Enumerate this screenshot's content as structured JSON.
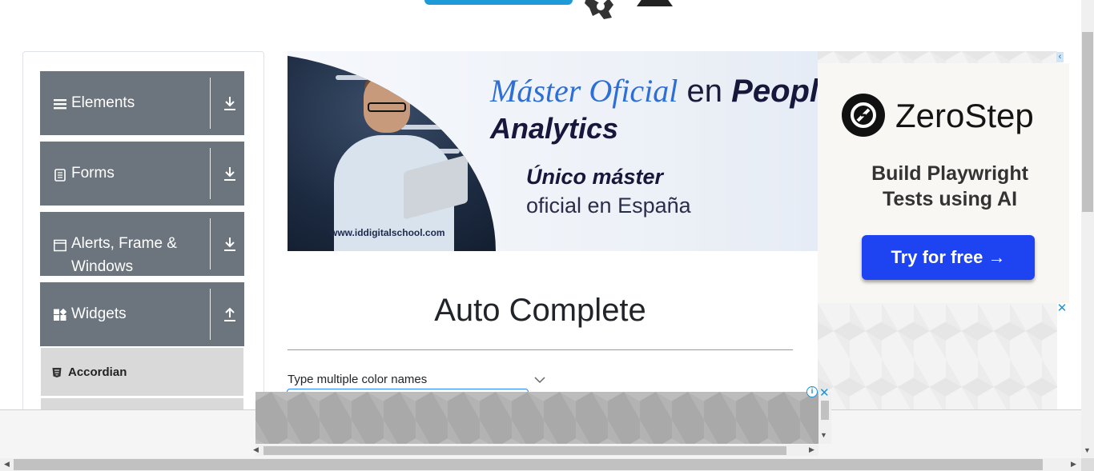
{
  "sidebar": {
    "groups": [
      {
        "label": "Elements",
        "icon": "hamburger-icon",
        "state": "collapsed"
      },
      {
        "label": "Forms",
        "icon": "document-icon",
        "state": "collapsed"
      },
      {
        "label": "Alerts, Frame &",
        "label_line2": "Windows",
        "icon": "window-icon",
        "state": "collapsed"
      },
      {
        "label": "Widgets",
        "icon": "widgets-icon",
        "state": "expanded"
      }
    ],
    "active_item": {
      "label": "Accordian",
      "icon": "html5-icon"
    }
  },
  "banner_ad": {
    "headline_italic": "Máster Oficial",
    "headline_mid": " en ",
    "headline_bold": "People",
    "headline_line2": "Analytics",
    "tag_bold": "Único máster",
    "tag_regular": "oficial en España",
    "url": "www.iddigitalschool.com"
  },
  "right_ad": {
    "brand": "ZeroStep",
    "tagline": "Build Playwright Tests using AI",
    "cta": "Try for free →",
    "cta_color": "#1d44f0"
  },
  "main": {
    "title": "Auto Complete",
    "field_label": "Type multiple color names"
  },
  "icons": {
    "ad_choices": "ⓘ",
    "close": "✕"
  }
}
